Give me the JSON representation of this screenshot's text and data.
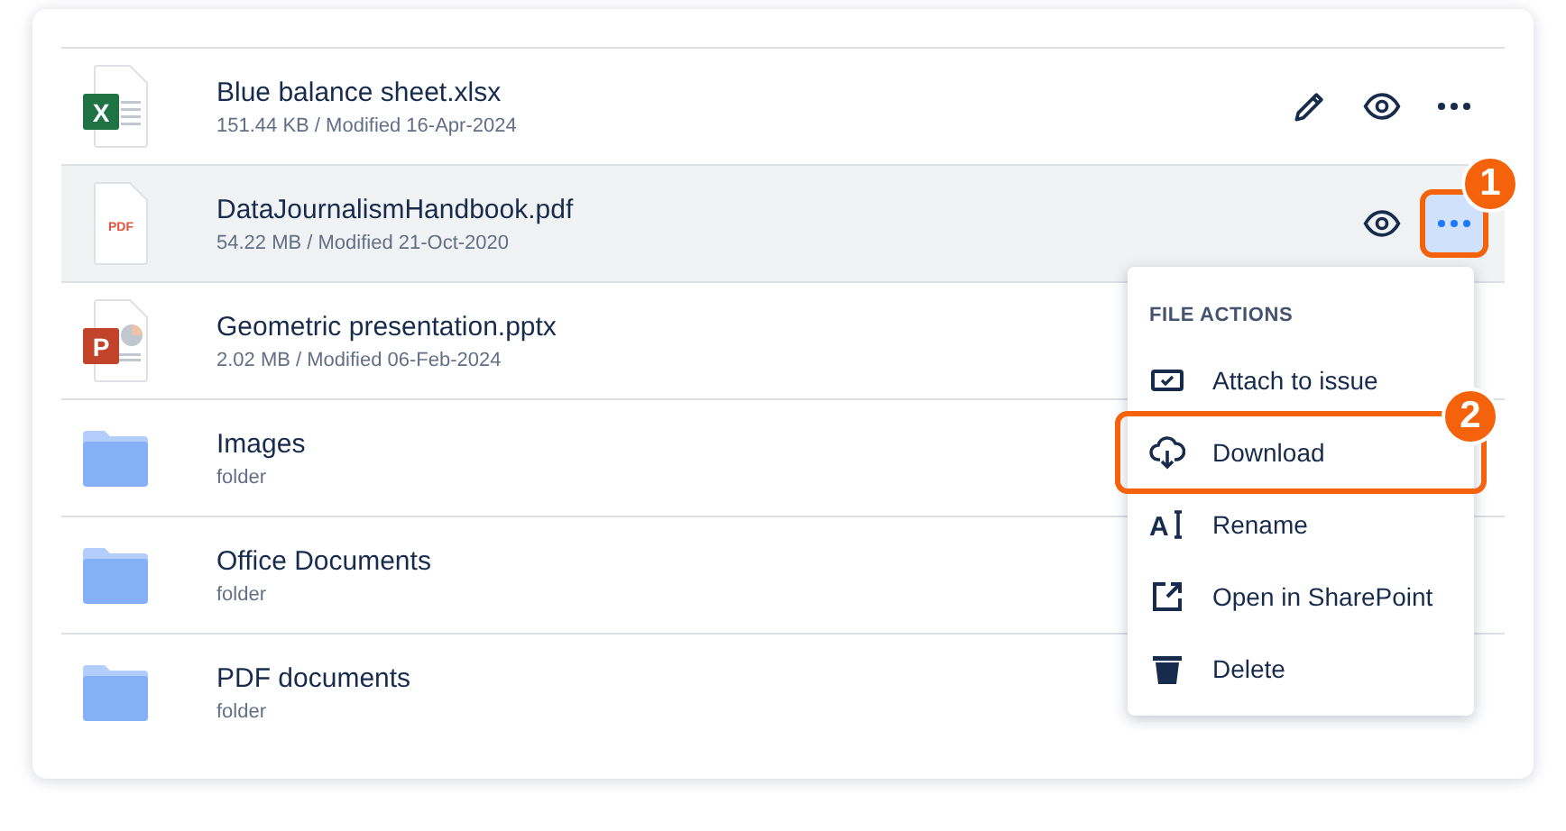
{
  "files": [
    {
      "kind": "xlsx",
      "icon_text": "X",
      "name": "Blue balance sheet.xlsx",
      "meta": "151.44 KB / Modified 16-Apr-2024",
      "selected": false,
      "actions": [
        {
          "kind": "edit",
          "active": false
        },
        {
          "kind": "view",
          "active": false
        },
        {
          "kind": "more",
          "active": false
        }
      ]
    },
    {
      "kind": "pdf",
      "icon_text": "PDF",
      "name": "DataJournalismHandbook.pdf",
      "meta": "54.22 MB / Modified 21-Oct-2020",
      "selected": true,
      "actions": [
        {
          "kind": "view",
          "active": false
        },
        {
          "kind": "more",
          "active": true,
          "callout": "1"
        }
      ]
    },
    {
      "kind": "pptx",
      "icon_text": "P",
      "name": "Geometric presentation.pptx",
      "meta": "2.02 MB / Modified 06-Feb-2024",
      "selected": false
    },
    {
      "kind": "folder",
      "name": "Images",
      "meta": "folder",
      "selected": false
    },
    {
      "kind": "folder",
      "name": "Office Documents",
      "meta": "folder",
      "selected": false
    },
    {
      "kind": "folder",
      "name": "PDF documents",
      "meta": "folder",
      "selected": false
    }
  ],
  "menu": {
    "heading": "FILE ACTIONS",
    "items": [
      {
        "kind": "attach",
        "label": "Attach to issue"
      },
      {
        "kind": "download",
        "label": "Download",
        "callout": "2"
      },
      {
        "kind": "rename",
        "icon_text": "A",
        "label": "Rename"
      },
      {
        "kind": "open",
        "label": "Open in SharePoint"
      },
      {
        "kind": "delete",
        "label": "Delete"
      }
    ]
  }
}
